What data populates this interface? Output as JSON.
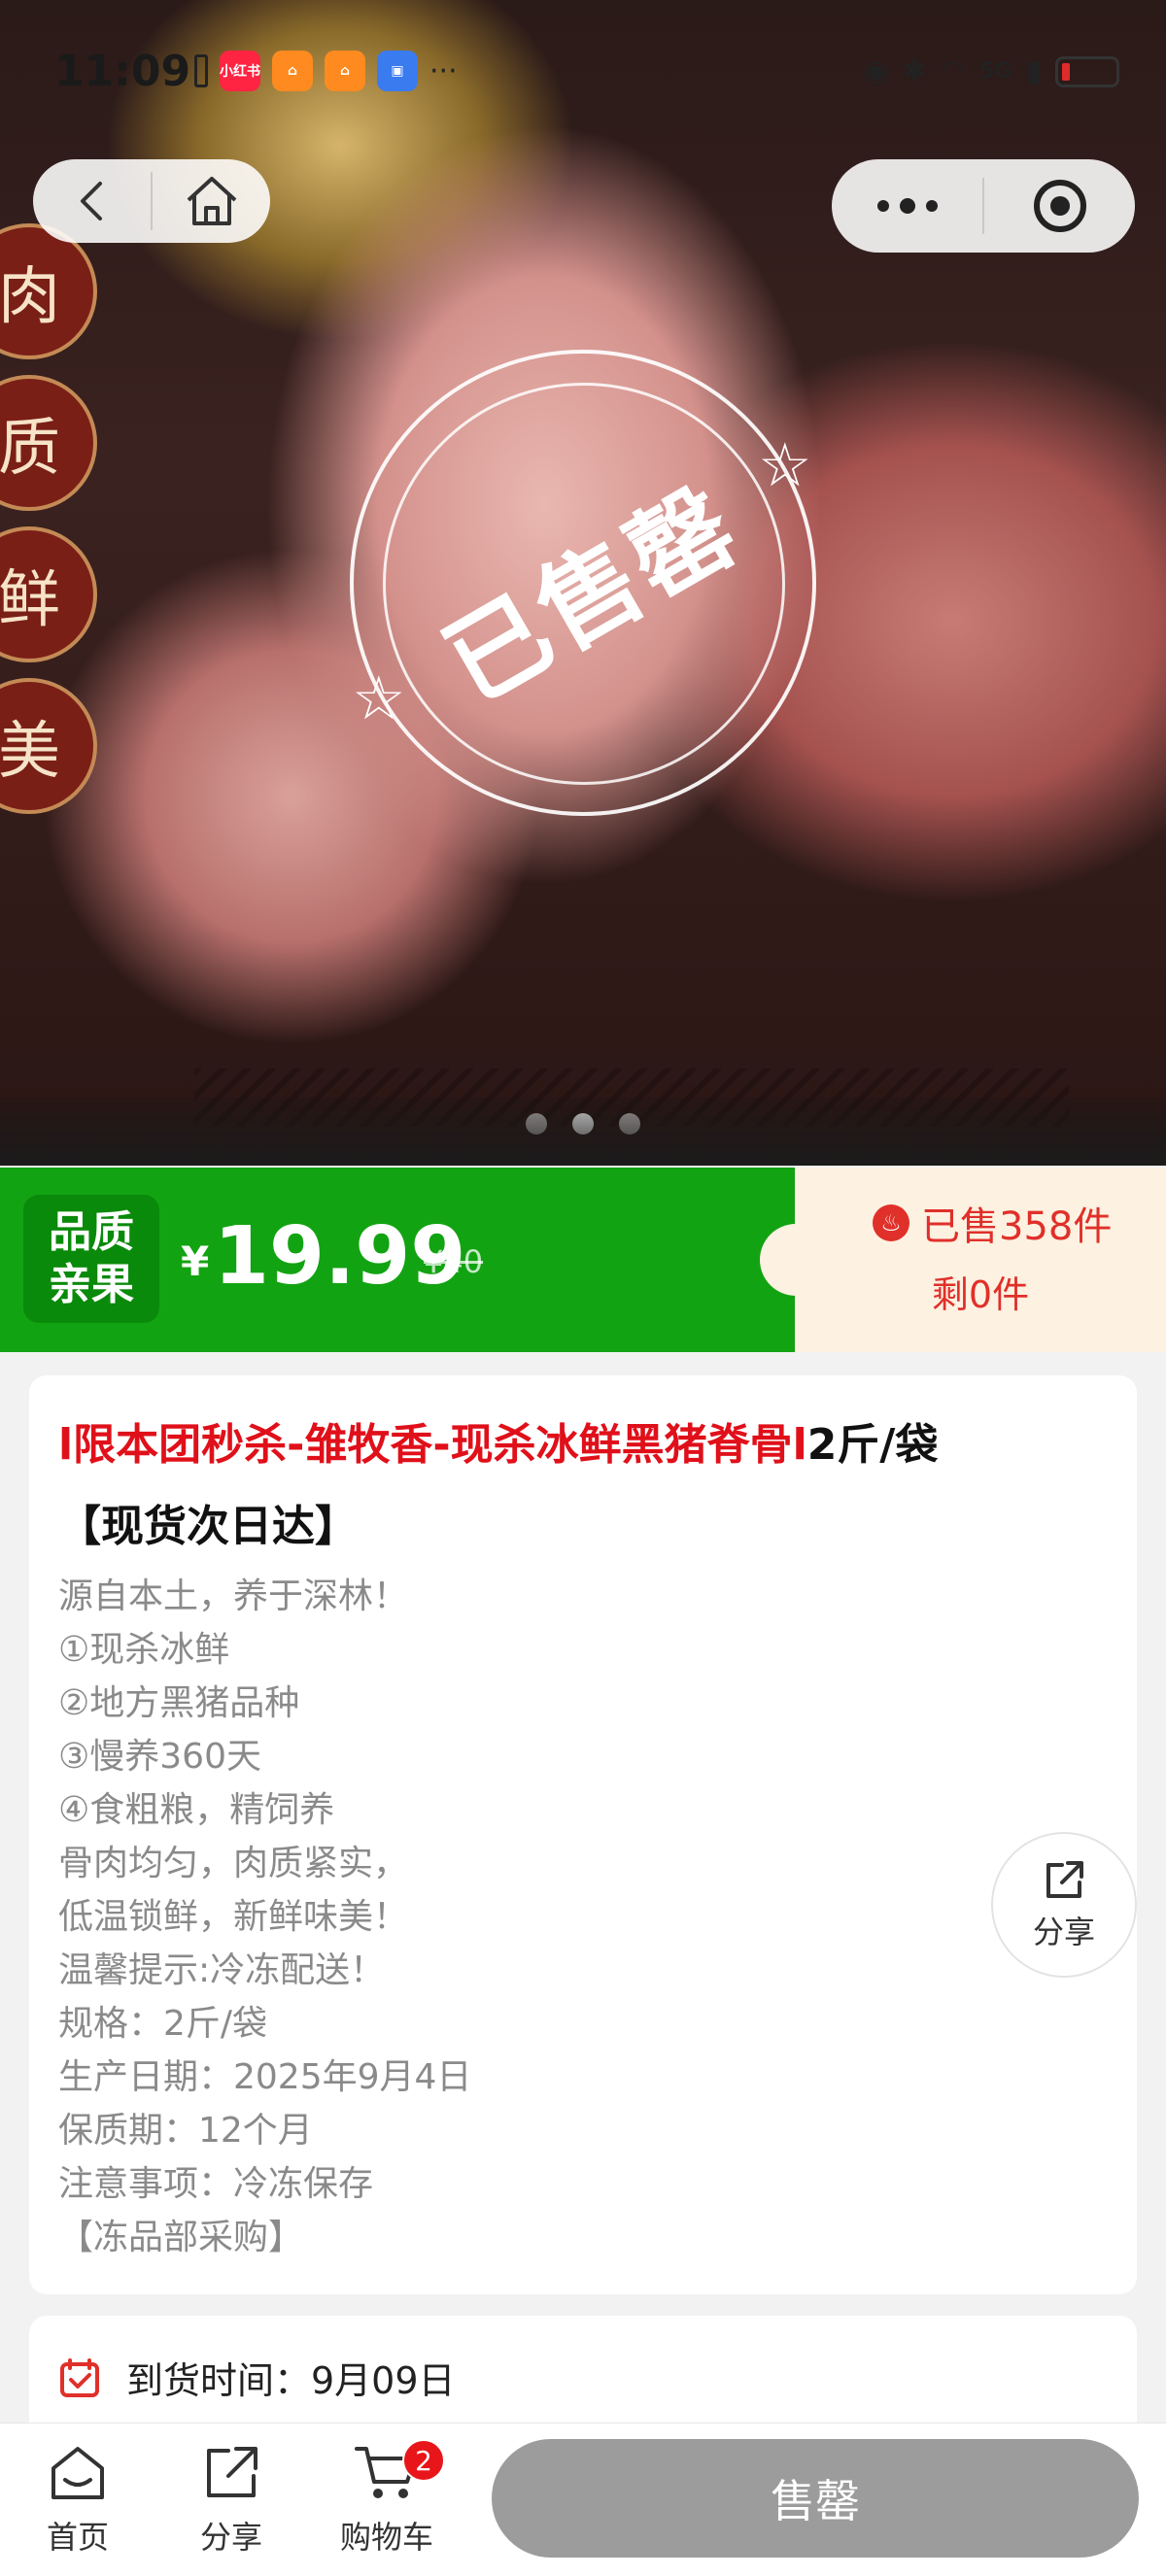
{
  "status_bar": {
    "time": "11:09",
    "signal_text": "5G",
    "apps": [
      {
        "name": "xiaohongshu-icon",
        "label": "小红书",
        "color": "#ff2442"
      },
      {
        "name": "app-orange-1-icon",
        "label": "",
        "color": "#ff8a1f"
      },
      {
        "name": "app-orange-2-icon",
        "label": "",
        "color": "#ff8a1f"
      },
      {
        "name": "app-blue-icon",
        "label": "",
        "color": "#3a7bf0"
      }
    ],
    "more": "···"
  },
  "hero": {
    "side_badges": [
      "肉",
      "质",
      "鲜",
      "美"
    ],
    "sold_out_stamp": "已售罄",
    "carousel_count": 3,
    "carousel_active": 1
  },
  "price_bar": {
    "quality_tag_line1": "品质",
    "quality_tag_line2": "亲果",
    "currency": "¥",
    "price": "19.99",
    "original_price": "¥40",
    "sold_text": "已售358件",
    "remaining_text": "剩0件",
    "accent_green": "#12a312",
    "accent_red": "#e0302a"
  },
  "product": {
    "title_red": "l限本团秒杀-雏牧香-现杀冰鲜黑猪脊骨l",
    "title_black": "2斤/袋",
    "title_line2": "【现货次日达】",
    "description": [
      "源自本土，养于深林！",
      "①现杀冰鲜",
      "②地方黑猪品种",
      "③慢养360天",
      "④食粗粮，精饲养",
      "骨肉均匀，肉质紧实，",
      "低温锁鲜，新鲜味美！",
      "温馨提示:冷冻配送！",
      "规格：2斤/袋",
      "生产日期：2025年9月4日",
      "保质期：12个月",
      "注意事项：冷冻保存",
      "【冻品部采购】"
    ],
    "share_label": "分享"
  },
  "delivery": {
    "text": "到货时间：9月09日"
  },
  "bottom_bar": {
    "home_label": "首页",
    "share_label": "分享",
    "cart_label": "购物车",
    "cart_count": "2",
    "buy_button_label": "售罄"
  }
}
